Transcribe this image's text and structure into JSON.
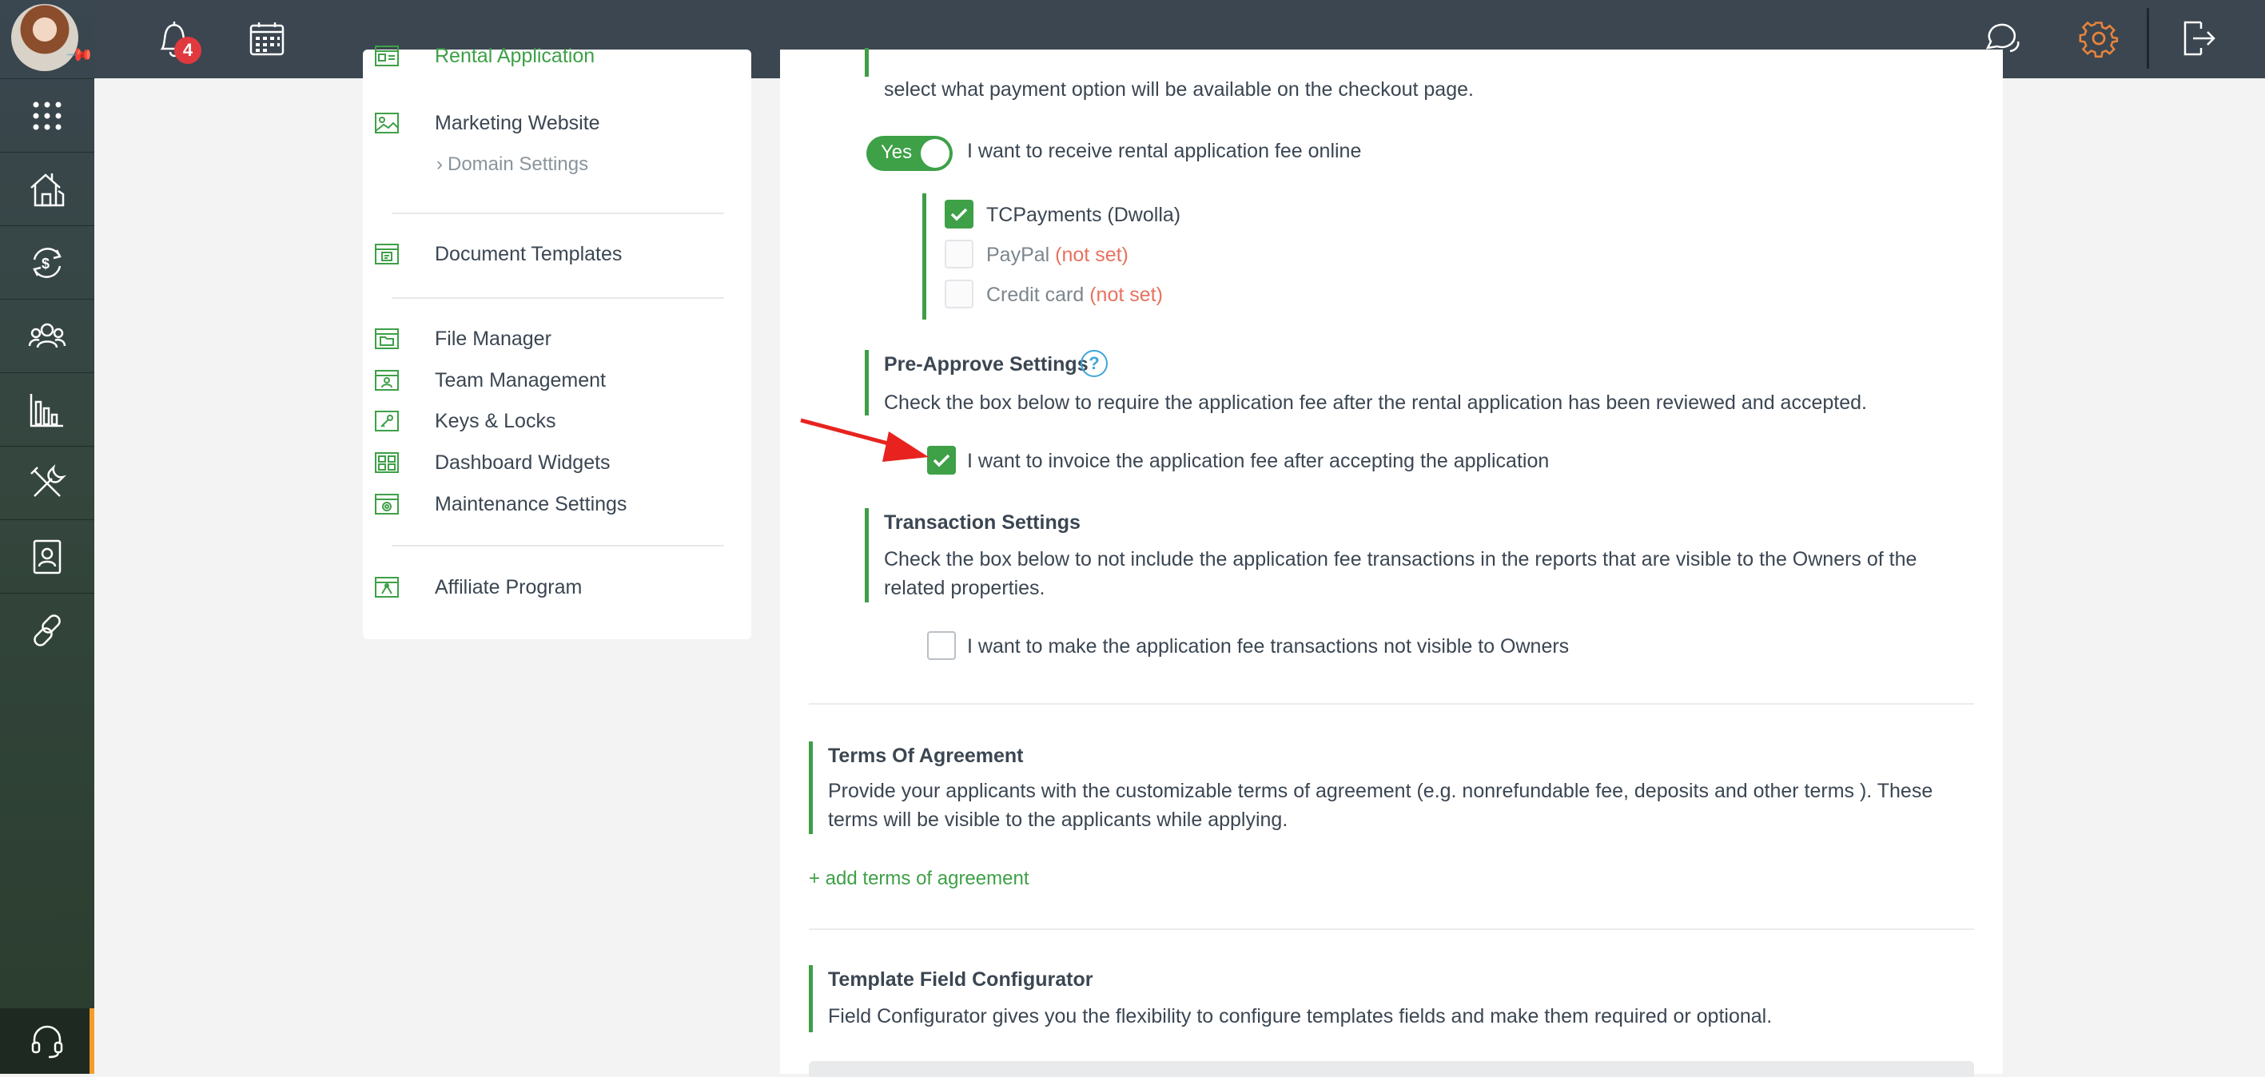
{
  "topbar": {
    "notification_count": "4",
    "icons": [
      "bell-icon",
      "calendar-icon",
      "chat-icon",
      "gear-icon",
      "logout-icon"
    ]
  },
  "leftnav": {
    "items": [
      "apps-icon",
      "properties-icon",
      "accounting-icon",
      "people-icon",
      "reports-icon",
      "maintenance-icon",
      "documents-icon",
      "links-icon"
    ],
    "support_icon": "headset-icon"
  },
  "menu": {
    "items": [
      {
        "label": "Rental Application",
        "active": true
      },
      {
        "label": "Marketing Website"
      },
      {
        "label": "Domain Settings"
      },
      {
        "label": "Document Templates"
      },
      {
        "label": "File Manager"
      },
      {
        "label": "Team Management"
      },
      {
        "label": "Keys & Locks"
      },
      {
        "label": "Dashboard Widgets"
      },
      {
        "label": "Maintenance Settings"
      },
      {
        "label": "Affiliate Program"
      }
    ]
  },
  "main": {
    "payment_desc_tail": "select what payment option will be available on the checkout page.",
    "online_fee": {
      "toggle_label": "Yes",
      "toggle_on": true,
      "label": "I want to receive rental application fee online"
    },
    "payment_options": [
      {
        "name": "TCPayments (Dwolla)",
        "checked": true,
        "status": ""
      },
      {
        "name": "PayPal",
        "checked": false,
        "status": "(not set)"
      },
      {
        "name": "Credit card",
        "checked": false,
        "status": "(not set)"
      }
    ],
    "pre_approve": {
      "title": "Pre-Approve Settings",
      "help": "?",
      "desc": "Check the box below to require the application fee after the rental application has been reviewed and accepted.",
      "checkbox_label": "I want to invoice the application fee after accepting the application",
      "checked": true
    },
    "transaction": {
      "title": "Transaction Settings",
      "desc_line1": "Check the box below to not include the application fee transactions in the reports that are visible to the Owners of the",
      "desc_line2": "related properties.",
      "checkbox_label": "I want to make the application fee transactions not visible to Owners",
      "checked": false
    },
    "terms": {
      "title": "Terms Of Agreement",
      "desc_line1": "Provide your applicants with the customizable terms of agreement (e.g. nonrefundable fee, deposits and other terms ). These",
      "desc_line2": "terms will be visible to the applicants while applying.",
      "add_link": "+ add terms of agreement"
    },
    "template_fields": {
      "title": "Template Field Configurator",
      "desc": "Field Configurator gives you the flexibility to configure templates fields and make them required or optional."
    }
  },
  "colors": {
    "topbar": "#3b4650",
    "accent_green": "#3ea047",
    "badge_red": "#e0393e",
    "gear_orange": "#e8843c",
    "not_set": "#e8725f",
    "annotation_arrow": "#e8231f"
  }
}
